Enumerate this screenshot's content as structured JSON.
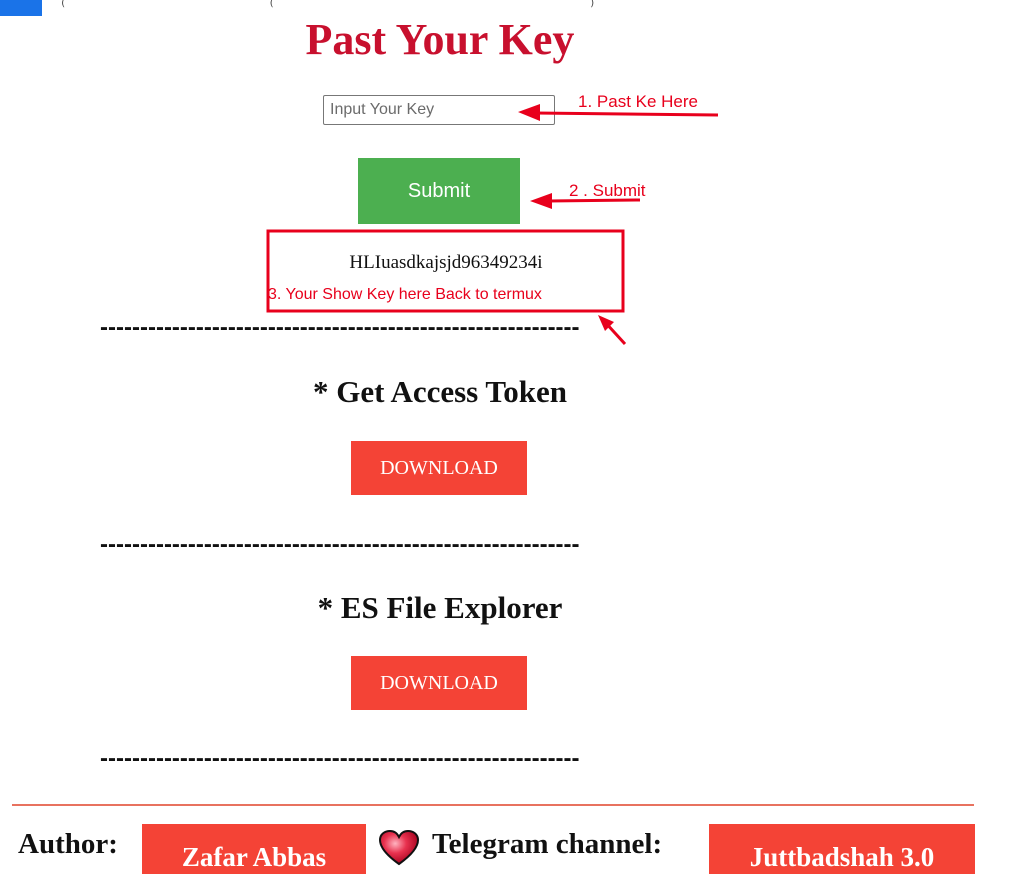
{
  "top_strip": {
    "text": "( _ _ _ _ _ _ _ _ _ _ _ _ ( _ _ _ _ _ _ _ _ _ _ _ _ _ _ _ _ _ _ _ )"
  },
  "form": {
    "title": "Past Your Key",
    "input_value": "",
    "input_placeholder": "Input Your Key",
    "submit_label": "Submit",
    "key_output": "HLIuasdkajsjd96349234i"
  },
  "separator": "------------------------------------------------------------",
  "sections": [
    {
      "heading": "* Get Access Token",
      "button_label": "DOWNLOAD"
    },
    {
      "heading": "* ES File Explorer",
      "button_label": "DOWNLOAD"
    }
  ],
  "footer": {
    "author_label": "Author:",
    "author_name": "Zafar Abbas",
    "heart_icon": "heart-icon",
    "telegram_label": "Telegram channel:",
    "telegram_name": "Juttbadshah 3.0"
  },
  "annotations": {
    "step1": "1. Past Ke Here",
    "step2": "2 . Submit",
    "step3": "3. Your Show Key here Back to termux"
  },
  "colors": {
    "title": "#c8102e",
    "submit": "#4caf50",
    "download": "#f44336",
    "annotation": "#e8001c",
    "footer_rule": "#e8725f"
  }
}
